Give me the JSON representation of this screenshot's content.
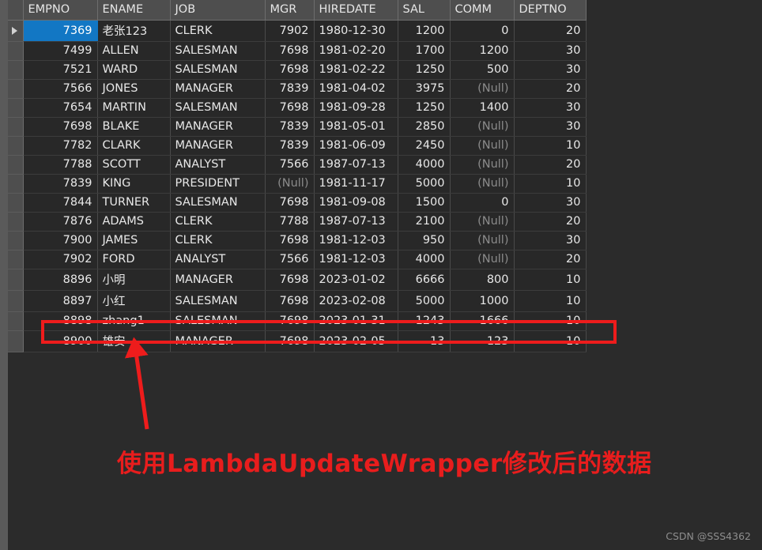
{
  "grid": {
    "columns": [
      {
        "key": "EMPNO",
        "label": "EMPNO",
        "align": "num"
      },
      {
        "key": "ENAME",
        "label": "ENAME",
        "align": "txt"
      },
      {
        "key": "JOB",
        "label": "JOB",
        "align": "txt"
      },
      {
        "key": "MGR",
        "label": "MGR",
        "align": "num"
      },
      {
        "key": "HIREDATE",
        "label": "HIREDATE",
        "align": "txt"
      },
      {
        "key": "SAL",
        "label": "SAL",
        "align": "num"
      },
      {
        "key": "COMM",
        "label": "COMM",
        "align": "num"
      },
      {
        "key": "DEPTNO",
        "label": "DEPTNO",
        "align": "num"
      }
    ],
    "null_text": "(Null)",
    "selected_row_index": 0,
    "selected_column_key": "EMPNO",
    "highlighted_row_index": 16,
    "rows": [
      {
        "EMPNO": "7369",
        "ENAME": "老张123",
        "JOB": "CLERK",
        "MGR": "7902",
        "HIREDATE": "1980-12-30",
        "SAL": "1200",
        "COMM": "0",
        "DEPTNO": "20"
      },
      {
        "EMPNO": "7499",
        "ENAME": "ALLEN",
        "JOB": "SALESMAN",
        "MGR": "7698",
        "HIREDATE": "1981-02-20",
        "SAL": "1700",
        "COMM": "1200",
        "DEPTNO": "30"
      },
      {
        "EMPNO": "7521",
        "ENAME": "WARD",
        "JOB": "SALESMAN",
        "MGR": "7698",
        "HIREDATE": "1981-02-22",
        "SAL": "1250",
        "COMM": "500",
        "DEPTNO": "30"
      },
      {
        "EMPNO": "7566",
        "ENAME": "JONES",
        "JOB": "MANAGER",
        "MGR": "7839",
        "HIREDATE": "1981-04-02",
        "SAL": "3975",
        "COMM": "(Null)",
        "DEPTNO": "20"
      },
      {
        "EMPNO": "7654",
        "ENAME": "MARTIN",
        "JOB": "SALESMAN",
        "MGR": "7698",
        "HIREDATE": "1981-09-28",
        "SAL": "1250",
        "COMM": "1400",
        "DEPTNO": "30"
      },
      {
        "EMPNO": "7698",
        "ENAME": "BLAKE",
        "JOB": "MANAGER",
        "MGR": "7839",
        "HIREDATE": "1981-05-01",
        "SAL": "2850",
        "COMM": "(Null)",
        "DEPTNO": "30"
      },
      {
        "EMPNO": "7782",
        "ENAME": "CLARK",
        "JOB": "MANAGER",
        "MGR": "7839",
        "HIREDATE": "1981-06-09",
        "SAL": "2450",
        "COMM": "(Null)",
        "DEPTNO": "10"
      },
      {
        "EMPNO": "7788",
        "ENAME": "SCOTT",
        "JOB": "ANALYST",
        "MGR": "7566",
        "HIREDATE": "1987-07-13",
        "SAL": "4000",
        "COMM": "(Null)",
        "DEPTNO": "20"
      },
      {
        "EMPNO": "7839",
        "ENAME": "KING",
        "JOB": "PRESIDENT",
        "MGR": "(Null)",
        "HIREDATE": "1981-11-17",
        "SAL": "5000",
        "COMM": "(Null)",
        "DEPTNO": "10"
      },
      {
        "EMPNO": "7844",
        "ENAME": "TURNER",
        "JOB": "SALESMAN",
        "MGR": "7698",
        "HIREDATE": "1981-09-08",
        "SAL": "1500",
        "COMM": "0",
        "DEPTNO": "30"
      },
      {
        "EMPNO": "7876",
        "ENAME": "ADAMS",
        "JOB": "CLERK",
        "MGR": "7788",
        "HIREDATE": "1987-07-13",
        "SAL": "2100",
        "COMM": "(Null)",
        "DEPTNO": "20"
      },
      {
        "EMPNO": "7900",
        "ENAME": "JAMES",
        "JOB": "CLERK",
        "MGR": "7698",
        "HIREDATE": "1981-12-03",
        "SAL": "950",
        "COMM": "(Null)",
        "DEPTNO": "30"
      },
      {
        "EMPNO": "7902",
        "ENAME": "FORD",
        "JOB": "ANALYST",
        "MGR": "7566",
        "HIREDATE": "1981-12-03",
        "SAL": "4000",
        "COMM": "(Null)",
        "DEPTNO": "20"
      },
      {
        "EMPNO": "8896",
        "ENAME": "小明",
        "JOB": "MANAGER",
        "MGR": "7698",
        "HIREDATE": "2023-01-02",
        "SAL": "6666",
        "COMM": "800",
        "DEPTNO": "10"
      },
      {
        "EMPNO": "8897",
        "ENAME": "小红",
        "JOB": "SALESMAN",
        "MGR": "7698",
        "HIREDATE": "2023-02-08",
        "SAL": "5000",
        "COMM": "1000",
        "DEPTNO": "10"
      },
      {
        "EMPNO": "8898",
        "ENAME": "zhang1",
        "JOB": "SALESMAN",
        "MGR": "7698",
        "HIREDATE": "2023-01-31",
        "SAL": "1243",
        "COMM": "1666",
        "DEPTNO": "10"
      },
      {
        "EMPNO": "8900",
        "ENAME": "雄安",
        "JOB": "MANAGER",
        "MGR": "7698",
        "HIREDATE": "2023-02-05",
        "SAL": "13",
        "COMM": "123",
        "DEPTNO": "10"
      }
    ]
  },
  "annotation": {
    "caption": "使用LambdaUpdateWrapper修改后的数据",
    "highlight_color": "#ee1c1c",
    "arrow_color": "#ee1c1c",
    "caption_color": "#e81d1d"
  },
  "watermark": {
    "text": "CSDN @SSS4362"
  }
}
